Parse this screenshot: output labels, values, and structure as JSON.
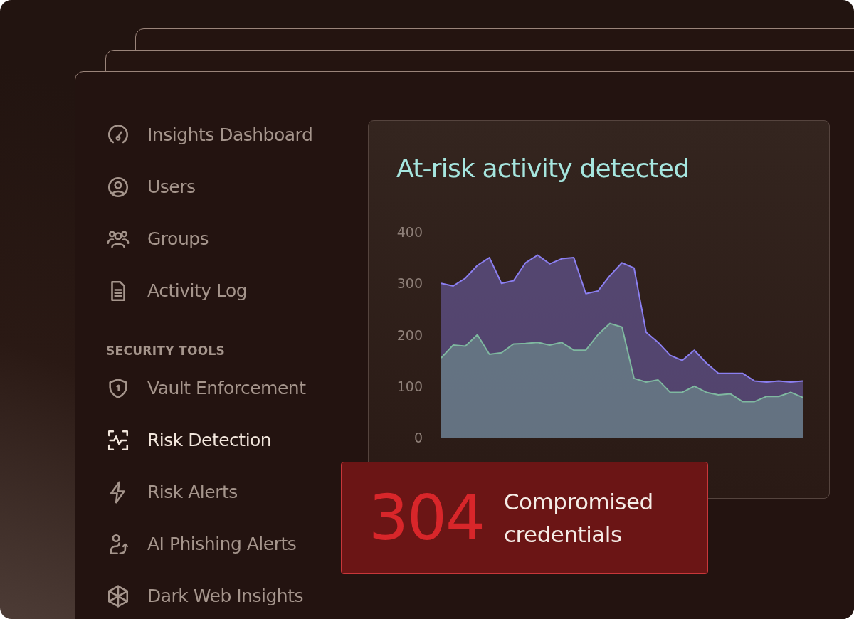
{
  "sidebar": {
    "items": [
      {
        "label": "Insights Dashboard",
        "selected": false
      },
      {
        "label": "Users",
        "selected": false
      },
      {
        "label": "Groups",
        "selected": false
      },
      {
        "label": "Activity Log",
        "selected": false
      }
    ],
    "section": {
      "title": "SECURITY TOOLS",
      "items": [
        {
          "label": "Vault Enforcement",
          "selected": false
        },
        {
          "label": "Risk Detection",
          "selected": true
        },
        {
          "label": "Risk Alerts",
          "selected": false
        },
        {
          "label": "AI Phishing Alerts",
          "selected": false
        },
        {
          "label": "Dark Web Insights",
          "selected": false
        }
      ]
    }
  },
  "chart_card": {
    "title": "At-risk activity detected",
    "chart_data": {
      "type": "area",
      "ylim": [
        0,
        400
      ],
      "yticks": [
        0,
        100,
        200,
        300,
        400
      ],
      "series": [
        {
          "color": "#8b7ff0",
          "values": [
            300,
            295,
            310,
            335,
            350,
            300,
            305,
            340,
            355,
            338,
            348,
            350,
            280,
            285,
            315,
            340,
            330,
            205,
            185,
            160,
            150,
            170,
            145,
            125,
            125,
            125,
            110,
            108,
            110,
            108,
            110
          ]
        },
        {
          "color": "#7fb8a0",
          "values": [
            155,
            180,
            178,
            200,
            162,
            165,
            182,
            183,
            185,
            180,
            185,
            170,
            170,
            200,
            222,
            215,
            115,
            108,
            112,
            88,
            88,
            100,
            88,
            83,
            85,
            70,
            70,
            80,
            80,
            88,
            78
          ]
        }
      ]
    }
  },
  "stat": {
    "value": "304",
    "label": "Compromised credentials"
  }
}
